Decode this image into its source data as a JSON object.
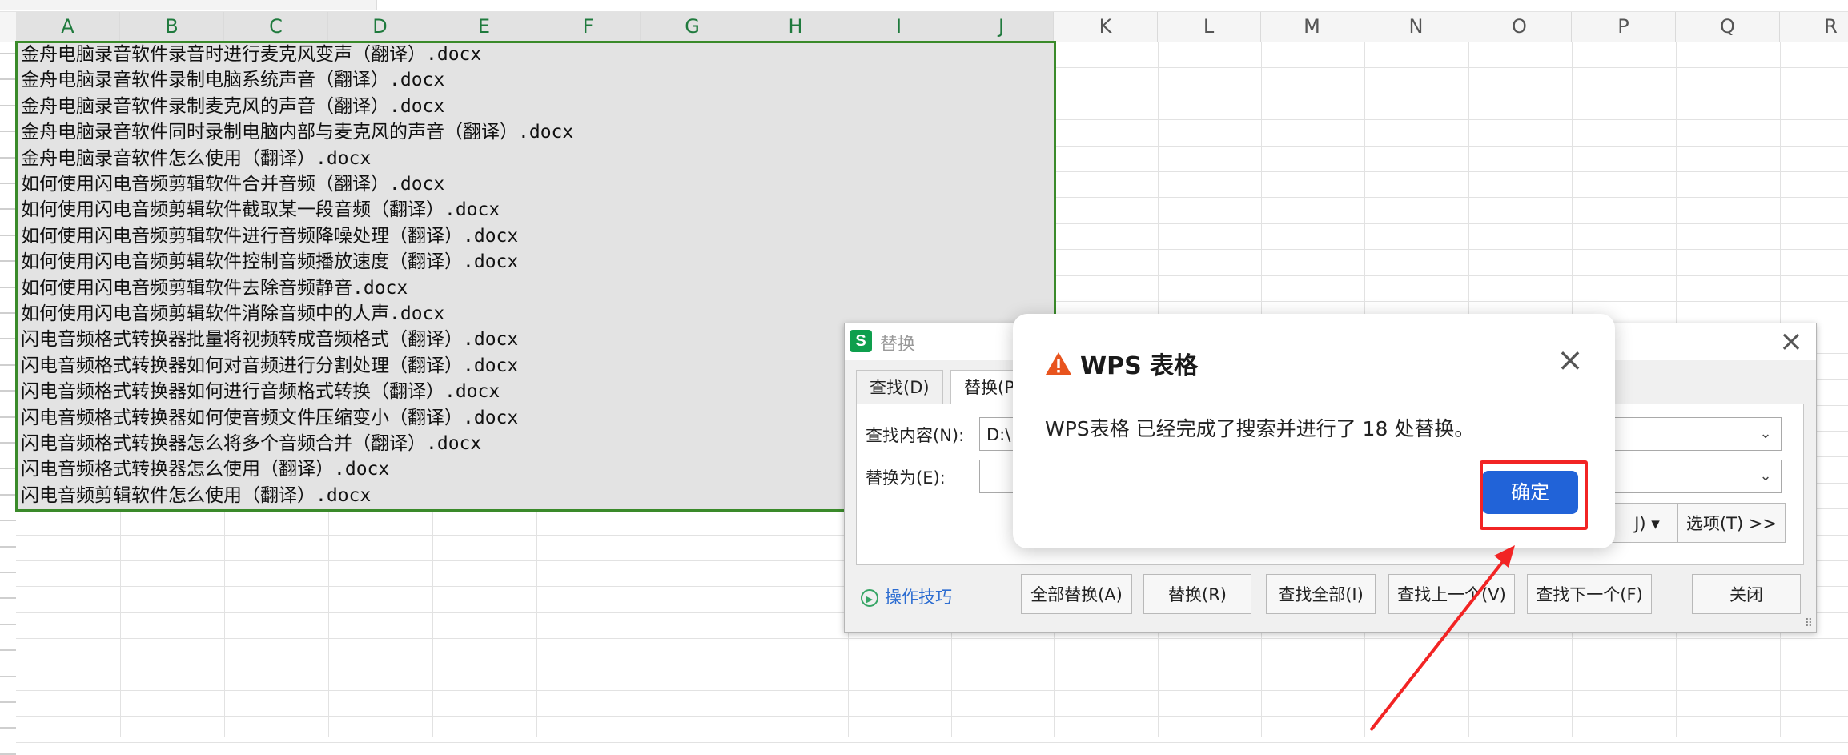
{
  "sheet": {
    "columns": [
      "A",
      "B",
      "C",
      "D",
      "E",
      "F",
      "G",
      "H",
      "I",
      "J",
      "K",
      "L",
      "M",
      "N",
      "O",
      "P",
      "Q",
      "R"
    ],
    "rows": [
      "金舟电脑录音软件录音时进行麦克风变声（翻译）.docx",
      "金舟电脑录音软件录制电脑系统声音（翻译）.docx",
      "金舟电脑录音软件录制麦克风的声音（翻译）.docx",
      "金舟电脑录音软件同时录制电脑内部与麦克风的声音（翻译）.docx",
      "金舟电脑录音软件怎么使用（翻译）.docx",
      "如何使用闪电音频剪辑软件合并音频（翻译）.docx",
      "如何使用闪电音频剪辑软件截取某一段音频（翻译）.docx",
      "如何使用闪电音频剪辑软件进行音频降噪处理（翻译）.docx",
      "如何使用闪电音频剪辑软件控制音频播放速度（翻译）.docx",
      "如何使用闪电音频剪辑软件去除音频静音.docx",
      "如何使用闪电音频剪辑软件消除音频中的人声.docx",
      "闪电音频格式转换器批量将视频转成音频格式（翻译）.docx",
      "闪电音频格式转换器如何对音频进行分割处理（翻译）.docx",
      "闪电音频格式转换器如何进行音频格式转换（翻译）.docx",
      "闪电音频格式转换器如何使音频文件压缩变小（翻译）.docx",
      "闪电音频格式转换器怎么将多个音频合并（翻译）.docx",
      "闪电音频格式转换器怎么使用（翻译）.docx",
      "闪电音频剪辑软件怎么使用（翻译）.docx"
    ]
  },
  "replace_dialog": {
    "app_icon": "S",
    "title": "替换",
    "tabs": [
      "查找(D)",
      "替换(P"
    ],
    "find_label": "查找内容(N):",
    "find_value": "D:\\",
    "replace_label": "替换为(E):",
    "replace_value": "",
    "format_btn": "J) ▾",
    "options_btn": "选项(T) >>",
    "tips": "操作技巧",
    "buttons": [
      "全部替换(A)",
      "替换(R)",
      "查找全部(I)",
      "查找上一个(V)",
      "查找下一个(F)",
      "关闭"
    ]
  },
  "alert": {
    "title": "WPS 表格",
    "message": "WPS表格 已经完成了搜索并进行了 18 处替换。",
    "ok_label": "确定"
  },
  "colors": {
    "selection_border": "#3a8a2a",
    "ok_button": "#2163d8",
    "highlight": "#f22424",
    "warning": "#e8541e"
  }
}
